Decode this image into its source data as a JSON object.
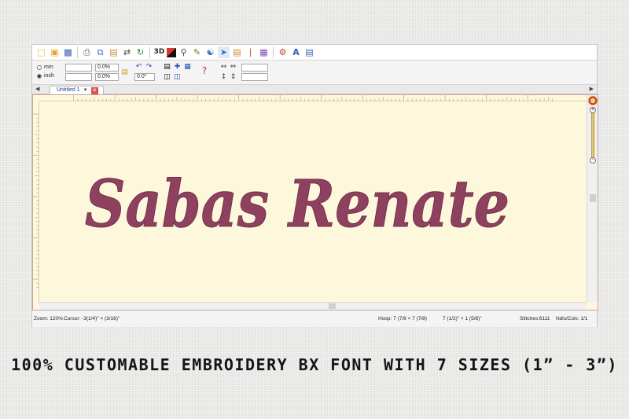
{
  "toolbar": {
    "icons": [
      "new-file-icon",
      "open-folder-icon",
      "save-icon",
      "print-icon",
      "copy-icon",
      "paste-icon",
      "mirror-icon",
      "rotate-icon",
      "3d-view-icon",
      "color-view-icon",
      "zoom-icon",
      "measure-icon",
      "hoop-icon",
      "select-icon",
      "stitch-list-icon",
      "needle-icon",
      "properties-icon",
      "settings-icon",
      "text-icon",
      "database-icon"
    ],
    "label_3d": "3D"
  },
  "units": {
    "mm_label": "mm",
    "inch_label": "inch",
    "selected": "inch"
  },
  "fields": {
    "width_value": "",
    "height_value": "",
    "width_pct": "0.0%",
    "height_pct": "0.0%",
    "angle": "0.0°",
    "spacing_value": ""
  },
  "tab": {
    "label": "Untitled 1"
  },
  "design": {
    "text": "Sabas  Renate",
    "thread_color": "#8a3e5c",
    "background_color": "#fdf8dc"
  },
  "status": {
    "zoom": "Zoom: 120%",
    "cursor": "Cursor: -3(1/4)\" × (3/16)\"",
    "hoop": "Hoop: 7 (7/8 × 7 (7/8)",
    "size": "7 (1/2)\" × 1 (5/8)\"",
    "stitches": "Stitches:6111",
    "ndls": "Ndls/Cols: 1/1"
  },
  "caption": "100% CUSTOMABLE EMBROIDERY BX FONT WITH 7 SIZES (1” -  3”)"
}
